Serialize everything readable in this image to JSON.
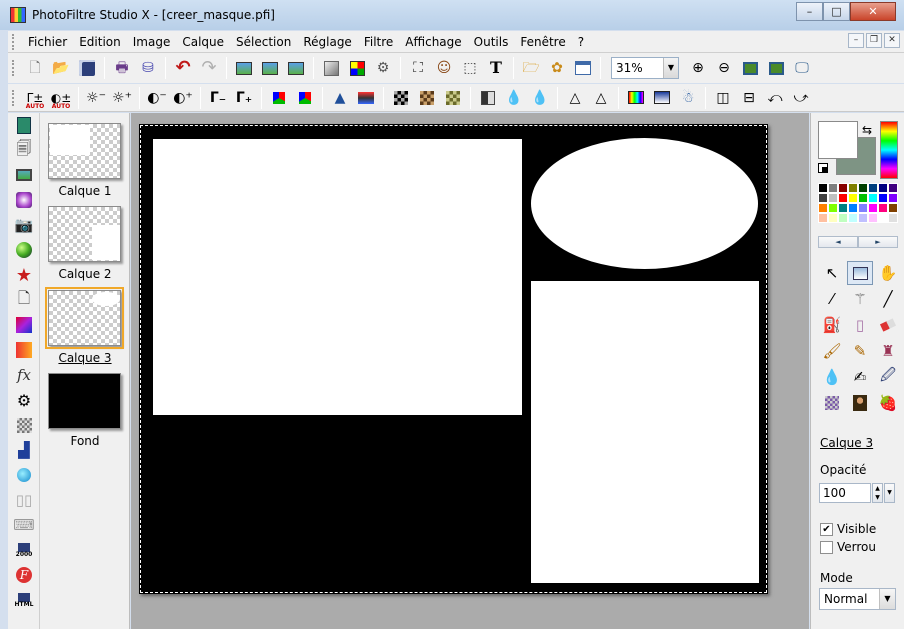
{
  "window": {
    "title": "PhotoFiltre Studio X - [creer_masque.pfi]",
    "controls": {
      "minimize": "–",
      "maximize": "□",
      "close": "✕"
    }
  },
  "menu": [
    "Fichier",
    "Edition",
    "Image",
    "Calque",
    "Sélection",
    "Réglage",
    "Filtre",
    "Affichage",
    "Outils",
    "Fenêtre",
    "?"
  ],
  "mdi_controls": {
    "minimize": "–",
    "restore": "❐",
    "close": "✕"
  },
  "toolbar": {
    "zoom_value": "31%",
    "auto_label": "AUTO"
  },
  "layers": [
    {
      "name": "Calque 1",
      "selected": false
    },
    {
      "name": "Calque 2",
      "selected": false
    },
    {
      "name": "Calque 3",
      "selected": true
    },
    {
      "name": "Fond",
      "selected": false
    }
  ],
  "left_tools": {
    "save_2000_label": "2000",
    "save_html_label": "HTML"
  },
  "colors": {
    "foreground": "#ffffff",
    "background": "#7e9484",
    "palette": [
      "#000000",
      "#7f7f7f",
      "#880000",
      "#808000",
      "#004000",
      "#003f7f",
      "#000080",
      "#400080",
      "#404040",
      "#c0c0c0",
      "#ff0000",
      "#ffff00",
      "#00c000",
      "#00ffff",
      "#0000ff",
      "#8000ff",
      "#ff8000",
      "#80ff00",
      "#008080",
      "#0080ff",
      "#8080ff",
      "#ff00ff",
      "#ff0080",
      "#804000",
      "#ffc0a0",
      "#ffffc0",
      "#c0ffc0",
      "#c0ffff",
      "#c0c0ff",
      "#ffc0ff",
      "#ffffff",
      "#e0e0e0"
    ]
  },
  "properties": {
    "layer_name": "Calque 3",
    "opacity_label": "Opacité",
    "opacity_value": "100",
    "visible_label": "Visible",
    "visible_checked": true,
    "lock_label": "Verrou",
    "lock_checked": false,
    "mode_label": "Mode",
    "mode_value": "Normal"
  }
}
